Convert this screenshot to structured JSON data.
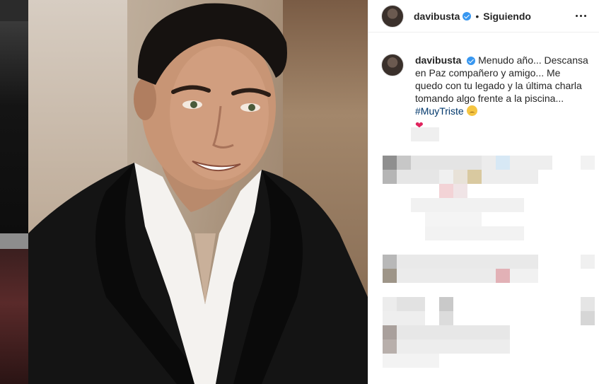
{
  "post": {
    "username": "davibusta",
    "follow_status": "Siguiendo",
    "dot": "•",
    "caption": "Menudo año... Descansa en Paz compañero y amigo... Me quedo con tu legado y la última charla tomando algo frente a la piscina...",
    "hashtag": "#MuyTriste",
    "emoji_icon": "sad-face-emoji",
    "heart": "❤"
  },
  "colors": {
    "verified_badge": "#3897f0",
    "hashtag": "#00376b",
    "heart": "#e0245e"
  }
}
